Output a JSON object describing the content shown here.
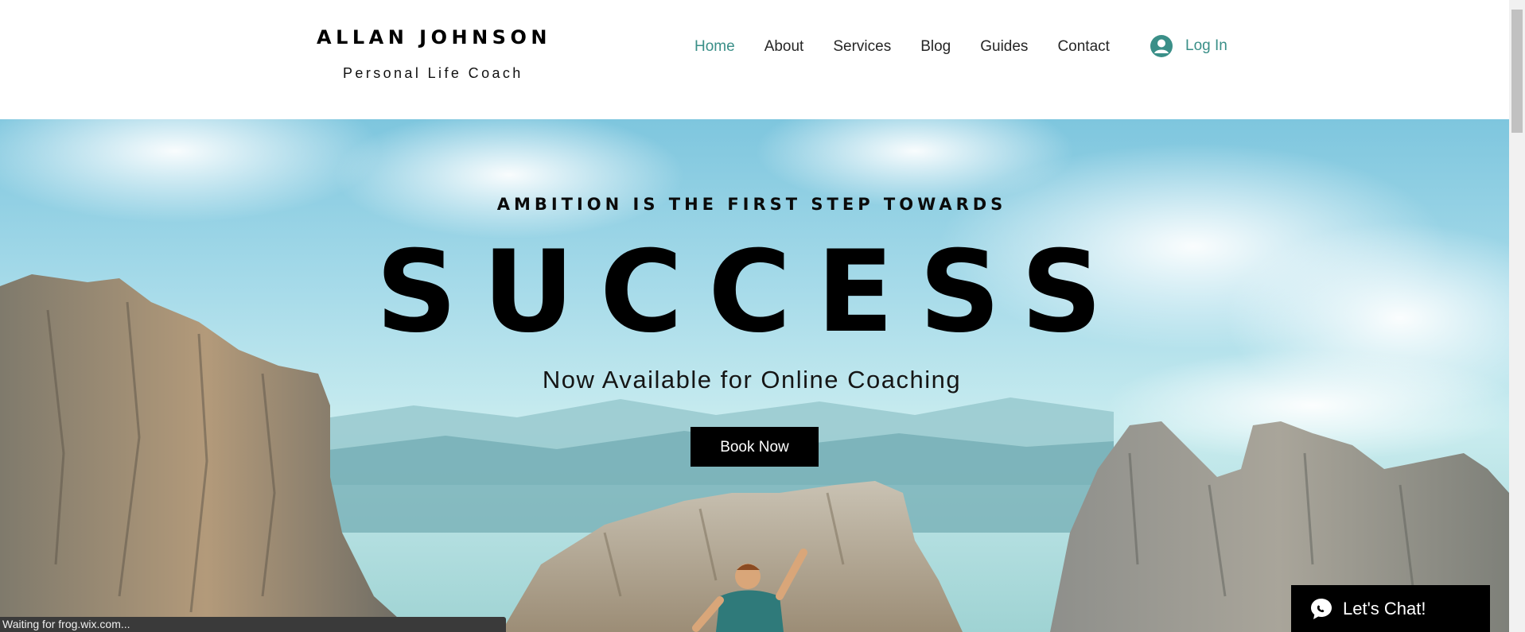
{
  "brand": {
    "name": "ALLAN JOHNSON",
    "tagline": "Personal Life Coach"
  },
  "nav": {
    "items": [
      {
        "label": "Home",
        "active": true
      },
      {
        "label": "About",
        "active": false
      },
      {
        "label": "Services",
        "active": false
      },
      {
        "label": "Blog",
        "active": false
      },
      {
        "label": "Guides",
        "active": false
      },
      {
        "label": "Contact",
        "active": false
      }
    ],
    "login_label": "Log In",
    "accent_color": "#3a8f88"
  },
  "hero": {
    "kicker": "AMBITION IS THE FIRST STEP TOWARDS",
    "title": "SUCCESS",
    "subtitle": "Now Available for Online Coaching",
    "cta_label": "Book Now"
  },
  "status": {
    "text": "Waiting for frog.wix.com..."
  },
  "chat": {
    "label": "Let's Chat!",
    "icon": "chat-bubble-icon"
  }
}
